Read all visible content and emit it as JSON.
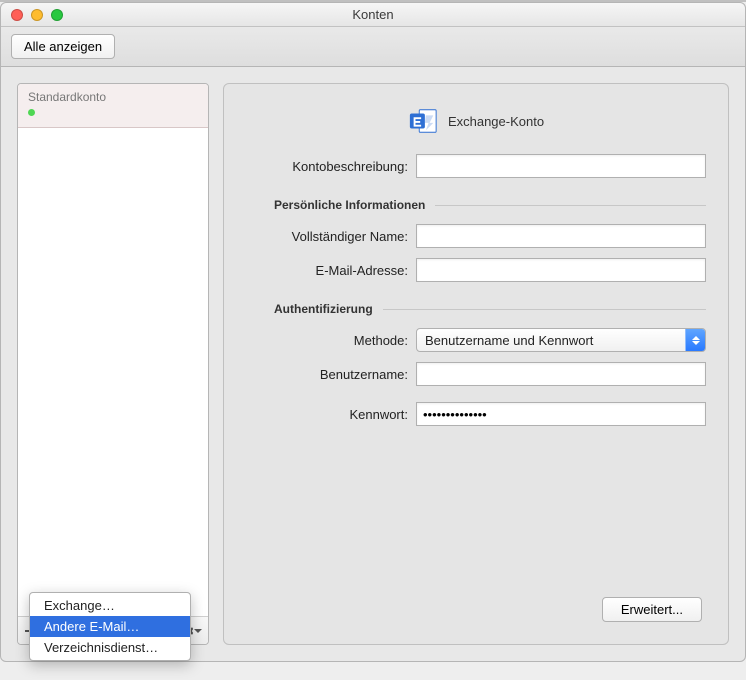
{
  "window_title": "Konten",
  "toolbar": {
    "show_all_label": "Alle anzeigen"
  },
  "sidebar": {
    "account": {
      "name": "Standardkonto",
      "status": "online"
    },
    "footer_icons": {
      "add": "plus-icon",
      "remove": "minus-icon",
      "settings": "gear-icon"
    }
  },
  "add_menu": {
    "items": [
      {
        "label": "Exchange…",
        "selected": false
      },
      {
        "label": "Andere E-Mail…",
        "selected": true
      },
      {
        "label": "Verzeichnisdienst…",
        "selected": false
      }
    ]
  },
  "main": {
    "brand": "Exchange-Konto",
    "labels": {
      "description": "Kontobeschreibung:",
      "full_name": "Vollständiger Name:",
      "email": "E-Mail-Adresse:",
      "method": "Methode:",
      "username": "Benutzername:",
      "password": "Kennwort:"
    },
    "section_personal": "Persönliche Informationen",
    "section_auth": "Authentifizierung",
    "method_value": "Benutzername und Kennwort",
    "values": {
      "description": "",
      "full_name": "",
      "email": "",
      "username": "",
      "password": "••••••••••••••"
    },
    "advanced_label": "Erweitert..."
  }
}
